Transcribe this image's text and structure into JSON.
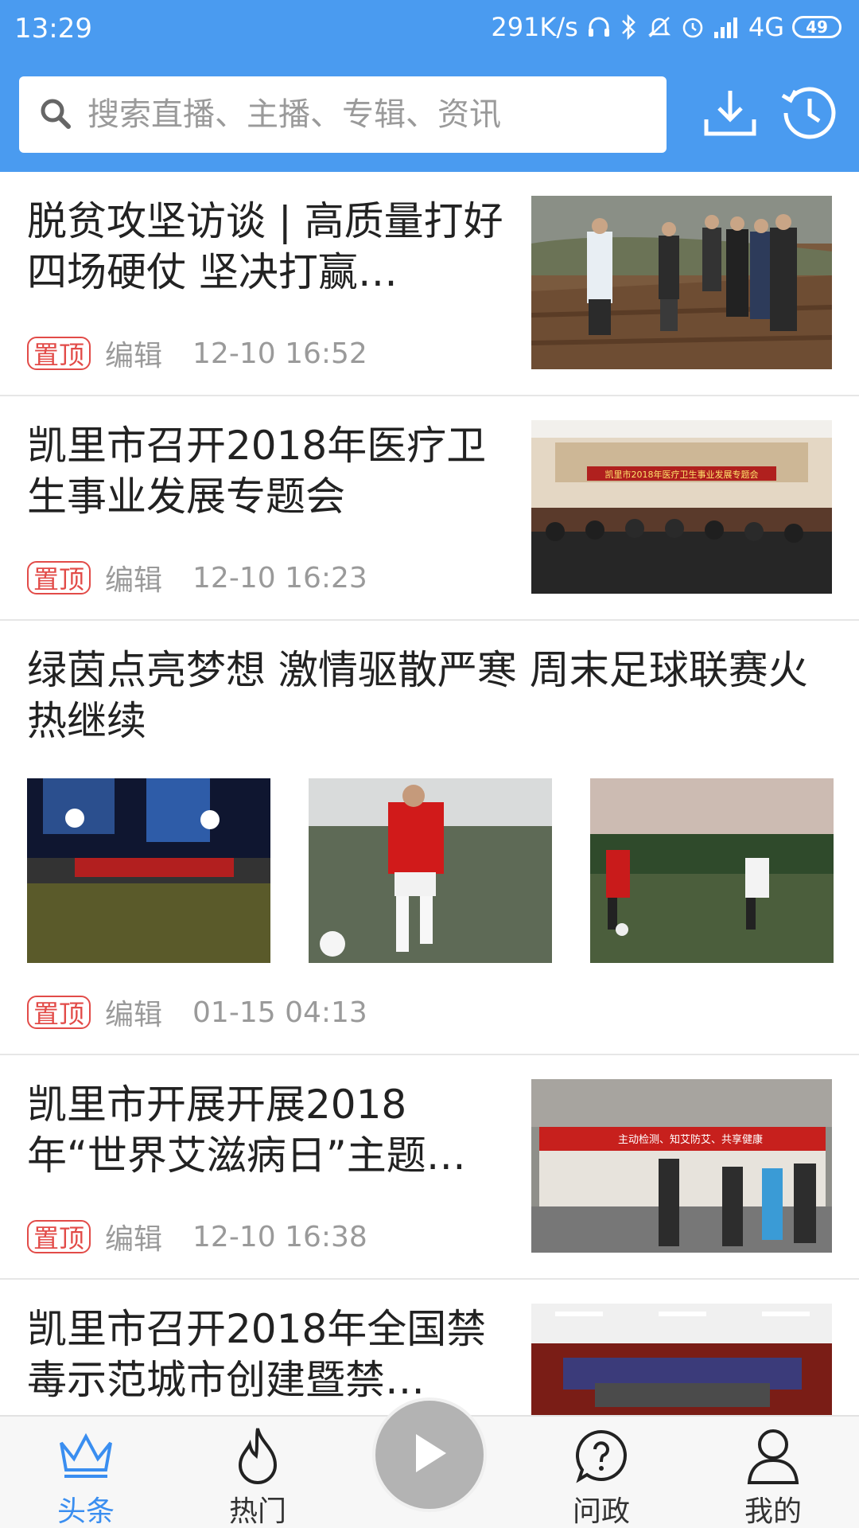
{
  "status_bar": {
    "time": "13:29",
    "speed": "291K/s",
    "network": "4G",
    "battery": "49"
  },
  "search": {
    "placeholder": "搜索直播、主播、专辑、资讯"
  },
  "feed": [
    {
      "title": "脱贫攻坚访谈 | 高质量打好四场硬仗 坚决打赢…",
      "badge": "置顶",
      "author": "编辑",
      "time": "12-10 16:52"
    },
    {
      "title": "凯里市召开2018年医疗卫生事业发展专题会",
      "badge": "置顶",
      "author": "编辑",
      "time": "12-10 16:23",
      "banner_text": "凯里市2018年医疗卫生事业发展专题会"
    },
    {
      "title": "绿茵点亮梦想 激情驱散严寒 周末足球联赛火热继续",
      "badge": "置顶",
      "author": "编辑",
      "time": "01-15 04:13"
    },
    {
      "title": "凯里市开展开展2018年“世界艾滋病日”主题…",
      "badge": "置顶",
      "author": "编辑",
      "time": "12-10 16:38",
      "banner_text": "主动检测、知艾防艾、共享健康"
    },
    {
      "title": "凯里市召开2018年全国禁毒示范城市创建暨禁…"
    }
  ],
  "bottom_nav": {
    "items": [
      {
        "label": "头条",
        "icon": "crown-icon",
        "active": true
      },
      {
        "label": "热门",
        "icon": "flame-icon"
      },
      {
        "label": "问政",
        "icon": "question-bubble-icon"
      },
      {
        "label": "我的",
        "icon": "person-icon"
      }
    ],
    "center_icon": "play-icon"
  },
  "colors": {
    "header_bg": "#4a9bf0",
    "badge": "#e24b48",
    "active_tab": "#3a8ef0"
  }
}
